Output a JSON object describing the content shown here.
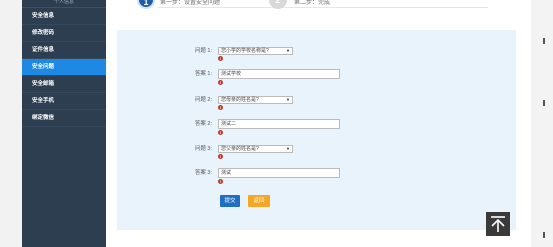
{
  "sidebar": {
    "top_label": "个人信息",
    "items": [
      {
        "label": "安全信息",
        "active": false
      },
      {
        "label": "修改密码",
        "active": false
      },
      {
        "label": "证件信息",
        "active": false
      },
      {
        "label": "安全问题",
        "active": true
      },
      {
        "label": "安全邮箱",
        "active": false
      },
      {
        "label": "安全手机",
        "active": false
      },
      {
        "label": "绑定微信",
        "active": false
      }
    ]
  },
  "steps": {
    "step1": {
      "number": "1",
      "label": "第一步：设置安全问题"
    },
    "step2": {
      "number": "2",
      "label": "第二步：完成"
    }
  },
  "form": {
    "q1_label": "问题 1:",
    "q1_value": "您小学的学校名称是?",
    "a1_label": "答案 1:",
    "a1_value": "测试学校",
    "q2_label": "问题 2:",
    "q2_value": "您母亲的姓名是?",
    "a2_label": "答案 2:",
    "a2_value": "测试二",
    "q3_label": "问题 3:",
    "q3_value": "您父亲的姓名是?",
    "a3_label": "答案 3:",
    "a3_value": "测试",
    "error_icon": "!",
    "select_caret": "▼"
  },
  "buttons": {
    "submit": "提交",
    "back": "返回"
  },
  "colors": {
    "sidebar_bg": "#2c3e50",
    "sidebar_active": "#1e88e5",
    "panel_bg": "#e8f3fc",
    "submit_bg": "#1e6fc4",
    "back_bg": "#f5a623",
    "step_active": "#1f5fa6"
  },
  "icons": {
    "back_to_top": "arrow-up-to-line-icon"
  }
}
